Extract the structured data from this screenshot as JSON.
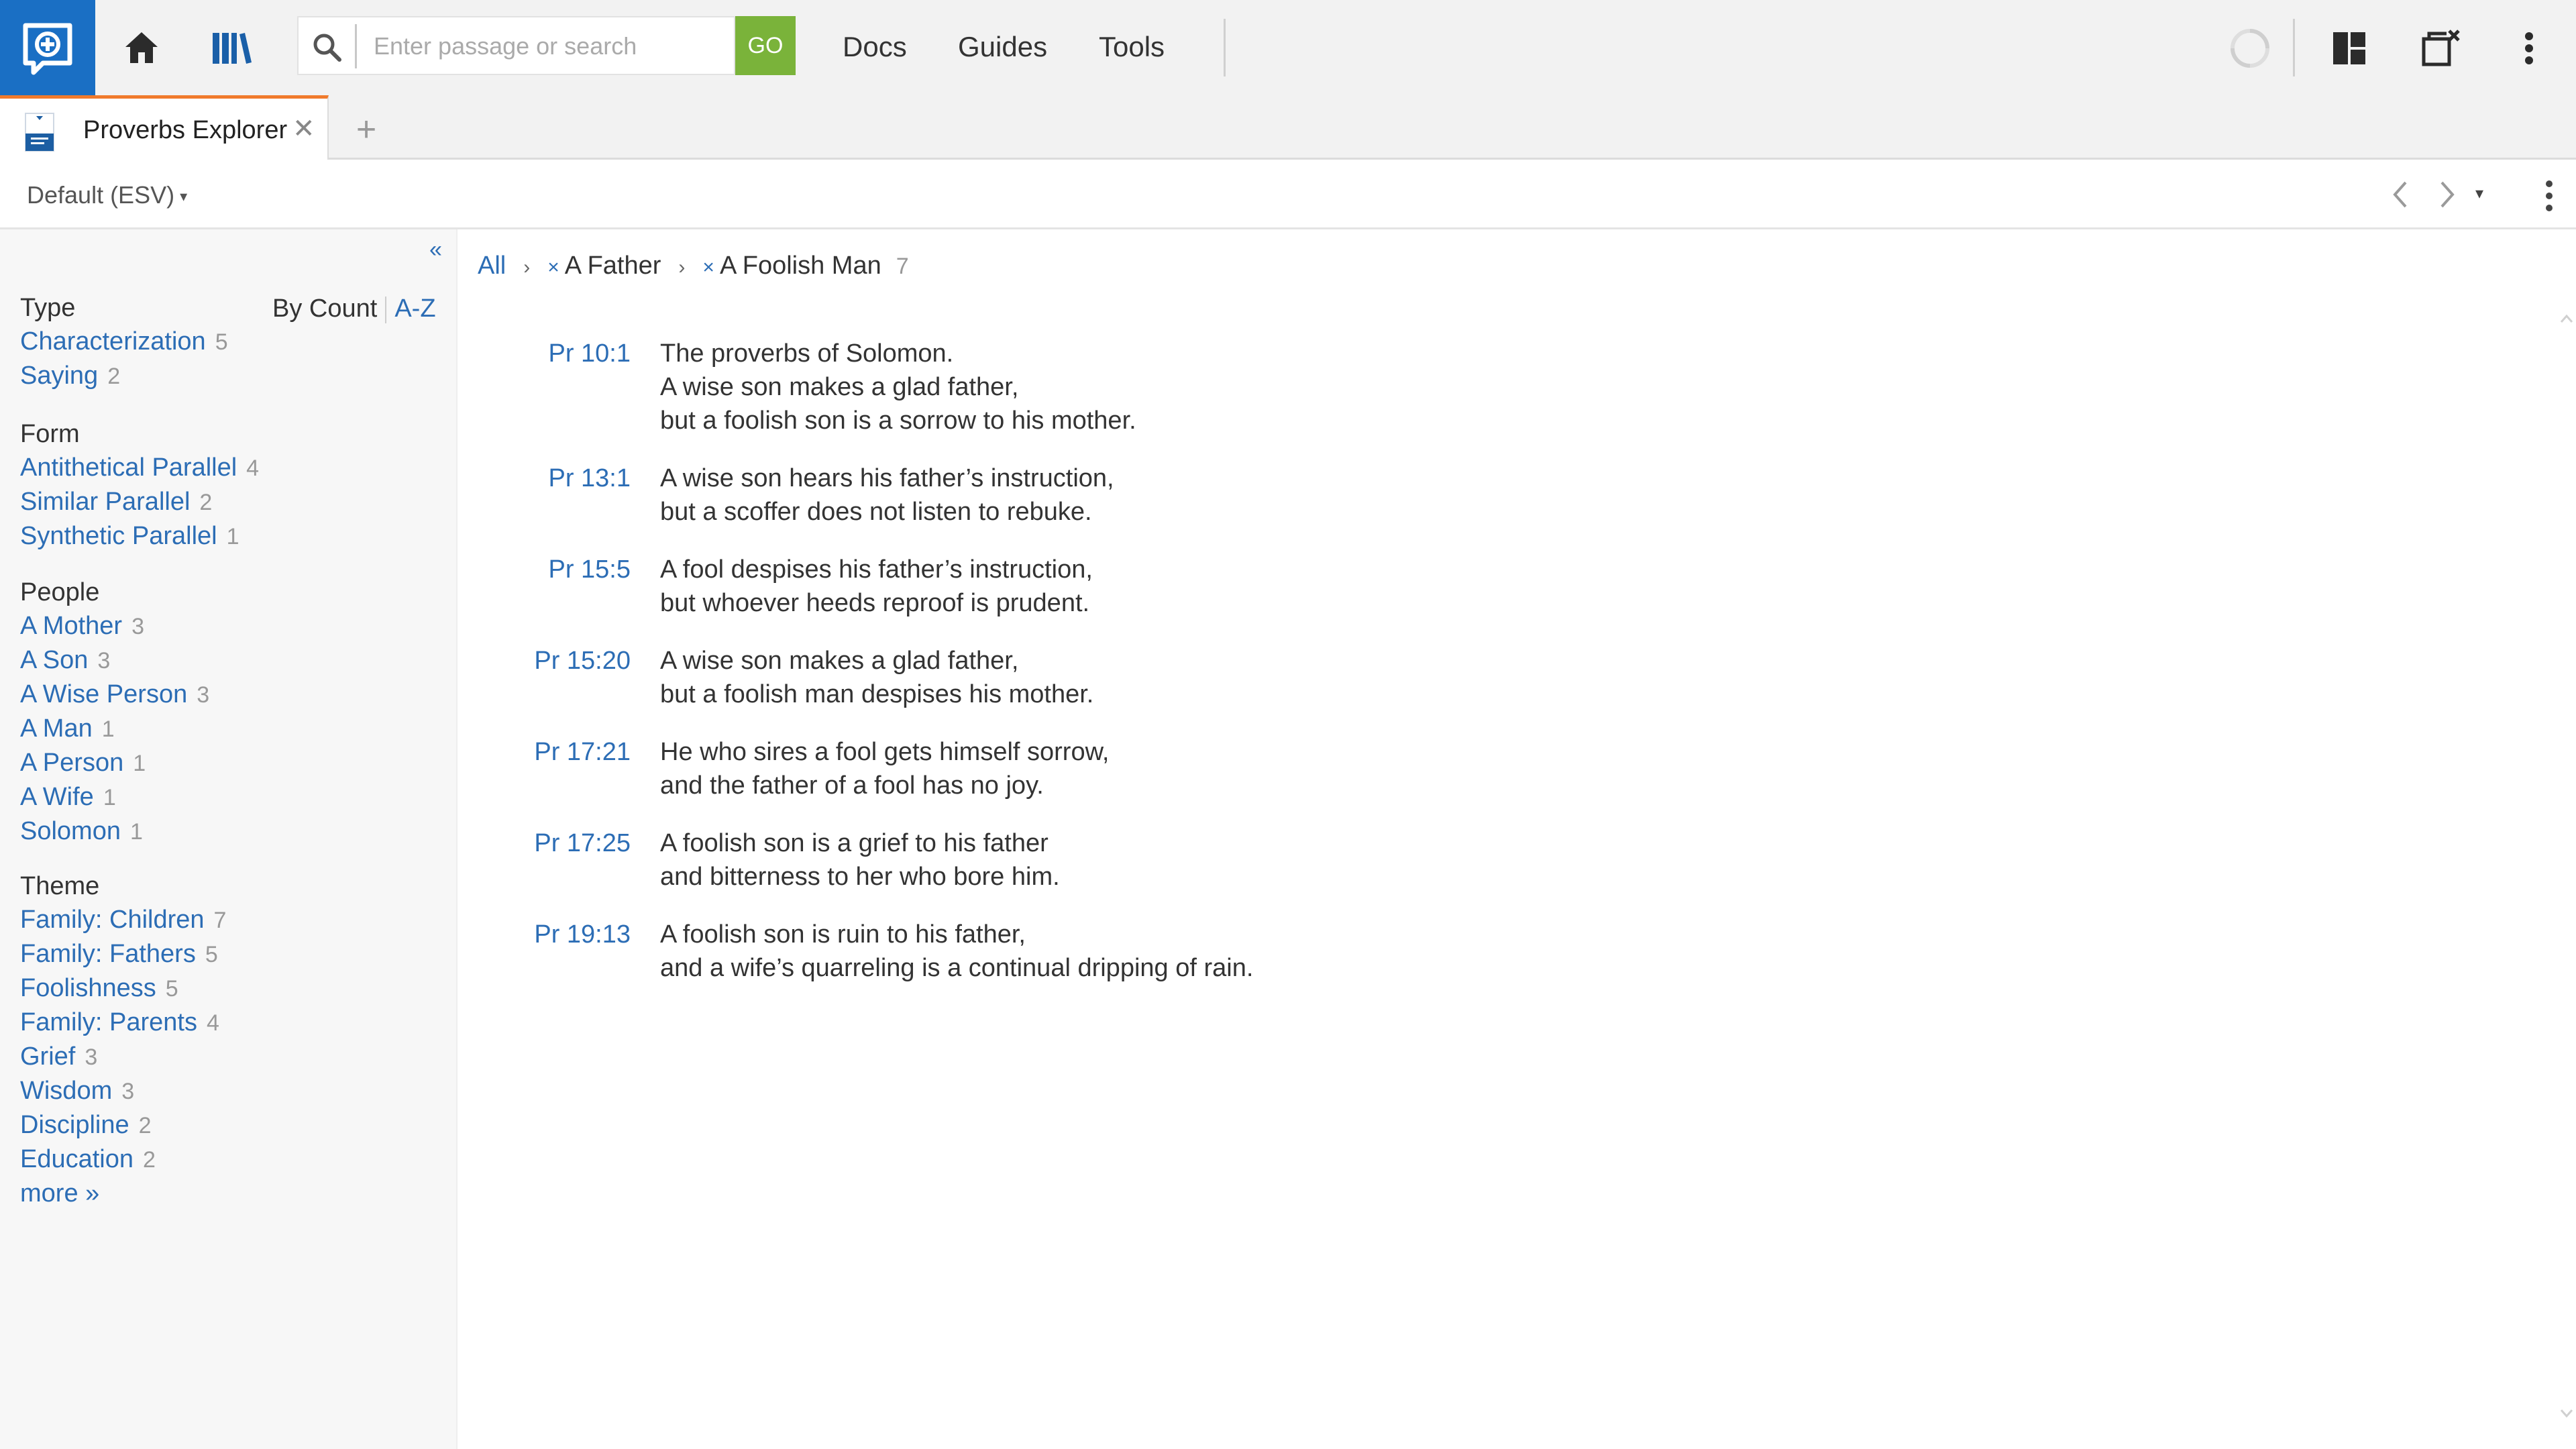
{
  "toolbar": {
    "search_placeholder": "Enter passage or search",
    "go_label": "GO",
    "nav": [
      "Docs",
      "Guides",
      "Tools"
    ],
    "accent_color": "#1a6fc4",
    "go_color": "#7ab33a"
  },
  "tab": {
    "label": "Proverbs Explorer",
    "close_glyph": "✕",
    "new_tab_glyph": "+",
    "active_color": "#f07a2c"
  },
  "panel": {
    "version": "Default (ESV)"
  },
  "sidebar": {
    "collapse_glyph": "«",
    "sort_by_count": "By Count",
    "sort_az": "A-Z",
    "groups": [
      {
        "title": "Type",
        "items": [
          {
            "label": "Characterization",
            "count": "5"
          },
          {
            "label": "Saying",
            "count": "2"
          }
        ]
      },
      {
        "title": "Form",
        "items": [
          {
            "label": "Antithetical Parallel",
            "count": "4"
          },
          {
            "label": "Similar Parallel",
            "count": "2"
          },
          {
            "label": "Synthetic Parallel",
            "count": "1"
          }
        ]
      },
      {
        "title": "People",
        "items": [
          {
            "label": "A Mother",
            "count": "3"
          },
          {
            "label": "A Son",
            "count": "3"
          },
          {
            "label": "A Wise Person",
            "count": "3"
          },
          {
            "label": "A Man",
            "count": "1"
          },
          {
            "label": "A Person",
            "count": "1"
          },
          {
            "label": "A Wife",
            "count": "1"
          },
          {
            "label": "Solomon",
            "count": "1"
          }
        ]
      },
      {
        "title": "Theme",
        "items": [
          {
            "label": "Family: Children",
            "count": "7"
          },
          {
            "label": "Family: Fathers",
            "count": "5"
          },
          {
            "label": "Foolishness",
            "count": "5"
          },
          {
            "label": "Family: Parents",
            "count": "4"
          },
          {
            "label": "Grief",
            "count": "3"
          },
          {
            "label": "Wisdom",
            "count": "3"
          },
          {
            "label": "Discipline",
            "count": "2"
          },
          {
            "label": "Education",
            "count": "2"
          }
        ]
      }
    ],
    "more_label": "more »"
  },
  "breadcrumb": {
    "all": "All",
    "chevron": "›",
    "remove_glyph": "×",
    "filters": [
      "A Father",
      "A Foolish Man"
    ],
    "result_count": "7"
  },
  "verses": [
    {
      "ref": "Pr 10:1",
      "lines": [
        "The proverbs of Solomon.",
        "A wise son makes a glad father,",
        "but a foolish son is a sorrow to his mother."
      ]
    },
    {
      "ref": "Pr 13:1",
      "lines": [
        "A wise son hears his father’s instruction,",
        "but a scoffer does not listen to rebuke."
      ]
    },
    {
      "ref": "Pr 15:5",
      "lines": [
        "A fool despises his father’s instruction,",
        "but whoever heeds reproof is prudent."
      ]
    },
    {
      "ref": "Pr 15:20",
      "lines": [
        "A wise son makes a glad father,",
        "but a foolish man despises his mother."
      ]
    },
    {
      "ref": "Pr 17:21",
      "lines": [
        "He who sires a fool gets himself sorrow,",
        "and the father of a fool has no joy."
      ]
    },
    {
      "ref": "Pr 17:25",
      "lines": [
        "A foolish son is a grief to his father",
        "and bitterness to her who bore him."
      ]
    },
    {
      "ref": "Pr 19:13",
      "lines": [
        "A foolish son is ruin to his father,",
        "and a wife’s quarreling is a continual dripping of rain."
      ]
    }
  ],
  "link_color": "#2c6db5"
}
